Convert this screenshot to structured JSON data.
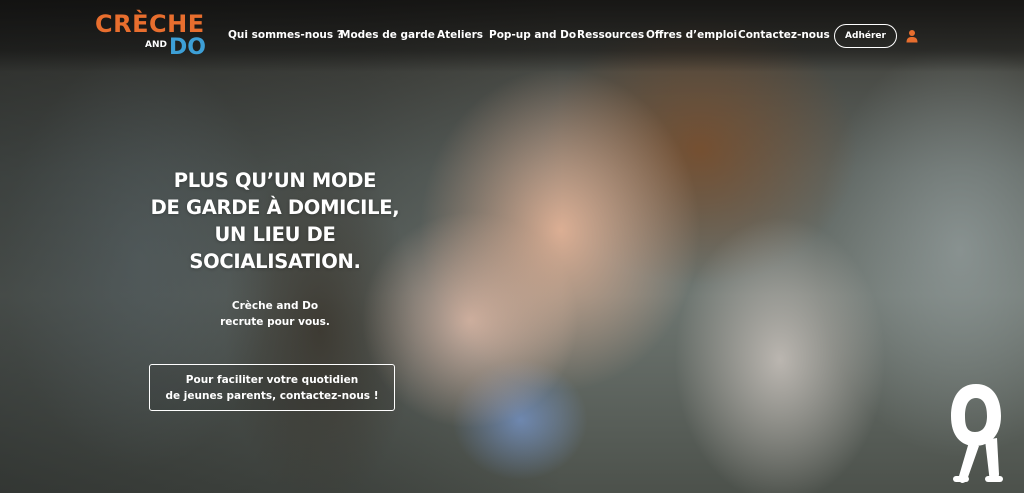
{
  "brand": {
    "logo_top": "CRÈCHE",
    "logo_and": "AND",
    "logo_do": "DO",
    "colors": {
      "orange": "#e86e2e",
      "blue": "#3d9fd6"
    }
  },
  "nav": {
    "items": [
      {
        "label": "Qui sommes-nous ?"
      },
      {
        "label": "Modes de garde"
      },
      {
        "label": "Ateliers"
      },
      {
        "label": "Pop-up and Do"
      },
      {
        "label": "Ressources"
      },
      {
        "label": "Offres d’emploi"
      },
      {
        "label": "Contactez-nous"
      }
    ],
    "join_label": "Adhérer",
    "user_icon": "user-icon"
  },
  "hero": {
    "headline": [
      "PLUS QU’UN MODE",
      "DE GARDE À DOMICILE,",
      "UN LIEU DE",
      "SOCIALISATION."
    ],
    "subline": [
      "Crèche and Do",
      "recrute pour vous."
    ],
    "cta": [
      "Pour faciliter votre quotidien",
      "de jeunes parents, contactez-nous !"
    ],
    "mascot_icon": "mascot-icon"
  }
}
